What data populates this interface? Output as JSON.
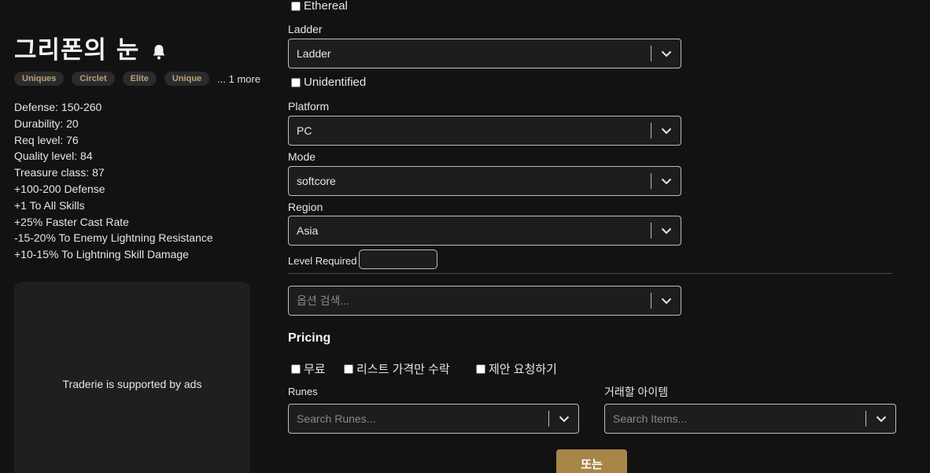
{
  "item": {
    "title": "그리폰의 눈",
    "tags": [
      "Uniques",
      "Circlet",
      "Elite",
      "Unique"
    ],
    "more": "... 1 more",
    "stats": [
      "Defense: 150-260",
      "Durability: 20",
      "Req level: 76",
      "Quality level: 84",
      "Treasure class: 87",
      "+100-200 Defense",
      "+1 To All Skills",
      "+25% Faster Cast Rate",
      "-15-20% To Enemy Lightning Resistance",
      "+10-15% To Lightning Skill Damage"
    ]
  },
  "ad": {
    "text": "Traderie is supported by ads"
  },
  "filters": {
    "ethereal": "Ethereal",
    "ladder_label": "Ladder",
    "ladder_value": "Ladder",
    "unidentified": "Unidentified",
    "platform_label": "Platform",
    "platform_value": "PC",
    "mode_label": "Mode",
    "mode_value": "softcore",
    "region_label": "Region",
    "region_value": "Asia",
    "level_required": "Level Required",
    "option_search_placeholder": "옵션 검색..."
  },
  "pricing": {
    "title": "Pricing",
    "free": "무료",
    "list_only": "리스트 가격만 수락",
    "request_offer": "제안 요청하기",
    "runes_label": "Runes",
    "runes_placeholder": "Search Runes...",
    "items_label": "거래할 아이템",
    "items_placeholder": "Search Items...",
    "or_button": "또는"
  },
  "colors": {
    "background": "#121212",
    "tag_text": "#b9a17a",
    "accent_button": "#a8864a"
  }
}
